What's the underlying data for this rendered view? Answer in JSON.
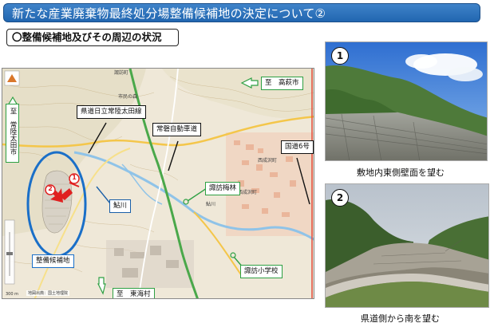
{
  "title": "新たな産業廃棄物最終処分場整備候補地の決定について②",
  "section_heading": "〇整備候補地及びその周辺の状況",
  "map": {
    "labels": {
      "route_hitachi_ota": "県道日立常陸太田線",
      "joban_expressway": "常磐自動車道",
      "route6": "国道6号",
      "to_takahagi": "至　高萩市",
      "to_hitachiota": "至　常陸太田市",
      "to_tokai": "至　東海村",
      "ayukawa": "鮎川",
      "suwa_bairin": "諏訪梅林",
      "suwa_school": "諏訪小学校",
      "candidate_site": "整備候補地"
    },
    "markers": [
      "1",
      "2"
    ],
    "credit": "地図出典：国土地理院",
    "scale": "300 m"
  },
  "photos": [
    {
      "number": "1",
      "caption": "敷地内東側壁面を望む"
    },
    {
      "number": "2",
      "caption": "県道側から南を望む"
    }
  ],
  "colors": {
    "title_bg": "#2a6fba",
    "label_blue": "#1a5fa8",
    "label_green": "#2ea043",
    "arrow_red": "#e02020",
    "ellipse_blue": "#1a6fc8"
  }
}
